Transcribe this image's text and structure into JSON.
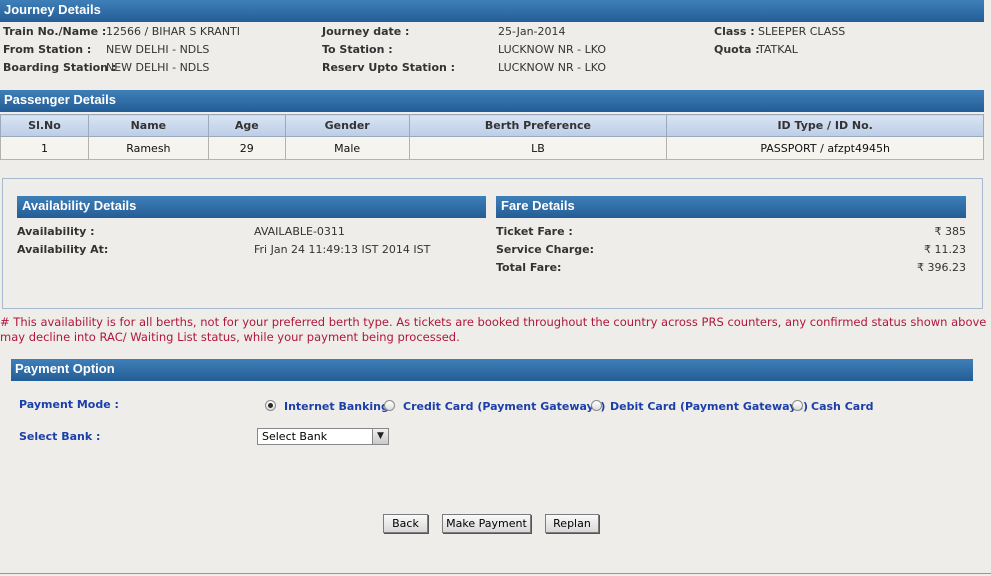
{
  "journey": {
    "title": "Journey Details",
    "train_label": "Train No./Name :",
    "train_value": "12566 / BIHAR S KRANTI",
    "from_label": "From Station :",
    "from_value": "NEW DELHI - NDLS",
    "boarding_label": "Boarding Station :",
    "boarding_value": "NEW DELHI - NDLS",
    "date_label": "Journey date :",
    "date_value": "25-Jan-2014",
    "to_label": "To Station :",
    "to_value": "LUCKNOW NR - LKO",
    "reserv_label": "Reserv Upto Station :",
    "reserv_value": "LUCKNOW NR - LKO",
    "class_label": "Class :",
    "class_value": "SLEEPER CLASS",
    "quota_label": "Quota :",
    "quota_value": "TATKAL"
  },
  "passenger": {
    "title": "Passenger Details",
    "columns": [
      "Sl.No",
      "Name",
      "Age",
      "Gender",
      "Berth Preference",
      "ID Type / ID No."
    ],
    "rows": [
      [
        "1",
        "Ramesh",
        "29",
        "Male",
        "LB",
        "PASSPORT / afzpt4945h"
      ]
    ]
  },
  "availability": {
    "title": "Availability Details",
    "avail_label": "Availability :",
    "avail_value": "AVAILABLE-0311",
    "at_label": "Availability At:",
    "at_value": "Fri Jan 24 11:49:13 IST 2014 IST"
  },
  "fare": {
    "title": "Fare Details",
    "currency_symbol": "₹",
    "ticket_label": "Ticket Fare :",
    "ticket_value": "385",
    "service_label": "Service Charge:",
    "service_value": "11.23",
    "total_label": "Total Fare:",
    "total_value": "396.23"
  },
  "note": "# This availability is for all berths, not for your preferred berth type. As tickets are booked throughout the country across PRS counters, any confirmed status shown above may decline into RAC/ Waiting List status, while your payment being processed.",
  "payment": {
    "title": "Payment Option",
    "mode_label": "Payment Mode :",
    "modes": [
      "Internet Banking",
      "Credit Card (Payment Gateways)",
      "Debit Card (Payment Gateways)",
      "Cash Card"
    ],
    "selected_mode": "Internet Banking",
    "bank_label": "Select Bank :",
    "bank_selected": "Select Bank"
  },
  "buttons": {
    "back": "Back",
    "make_payment": "Make Payment",
    "replan": "Replan"
  },
  "colors": {
    "header_blue": "#245d96",
    "label_blue": "#1c3fa8",
    "note_red": "#b0173a"
  }
}
